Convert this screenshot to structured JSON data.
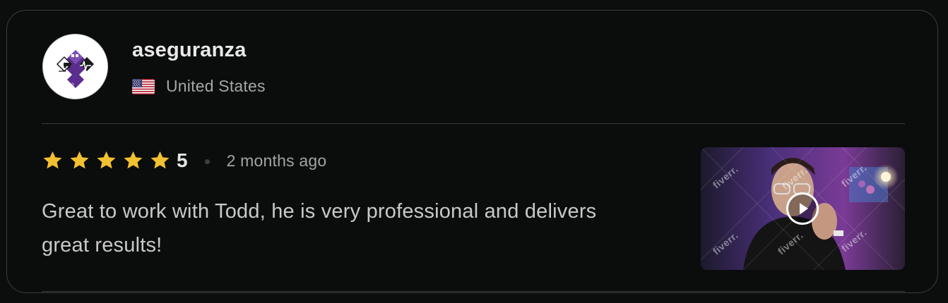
{
  "review": {
    "username": "aseguranza",
    "country": "United States",
    "flag_icon": "us-flag-icon",
    "rating": "5",
    "stars_filled": 5,
    "stars_total": 5,
    "time_ago": "2 months ago",
    "text": "Great to work with Todd, he is very professional and delivers great results!",
    "video": {
      "watermark": "fiverr.",
      "play_icon": "play-icon"
    }
  },
  "colors": {
    "background": "#0c0d0d",
    "star": "#f1c131",
    "avatar_purple": "#5b2d8e",
    "border": "#3b3d3d"
  }
}
